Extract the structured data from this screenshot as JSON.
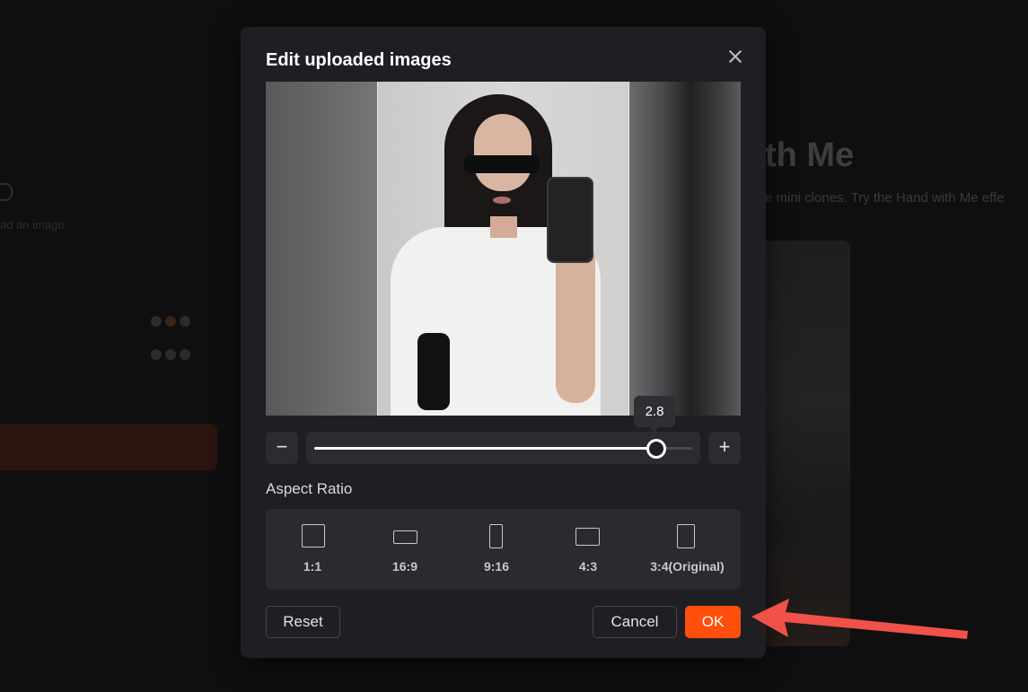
{
  "background": {
    "headline": "th Me",
    "subline": "e mini clones. Try the Hand with Me effe",
    "left_hint": "ad an image"
  },
  "dialog": {
    "title": "Edit uploaded images",
    "close_icon": "close-icon",
    "zoom": {
      "value": 2.8,
      "value_label": "2.8",
      "fill_fraction": 0.905,
      "minus_label": "−",
      "plus_label": "+"
    },
    "aspect_ratio": {
      "label": "Aspect Ratio",
      "options": [
        {
          "label": "1:1",
          "icon": "square-ratio-icon"
        },
        {
          "label": "16:9",
          "icon": "wide-ratio-icon"
        },
        {
          "label": "9:16",
          "icon": "tall-ratio-icon"
        },
        {
          "label": "4:3",
          "icon": "landscape-ratio-icon"
        },
        {
          "label": "3:4(Original)",
          "icon": "portrait-ratio-icon"
        }
      ]
    },
    "buttons": {
      "reset": "Reset",
      "cancel": "Cancel",
      "ok": "OK"
    }
  },
  "colors": {
    "accent": "#ff4f0a",
    "annotation_arrow": "#f0514a",
    "dialog_bg": "#1f1f23"
  }
}
